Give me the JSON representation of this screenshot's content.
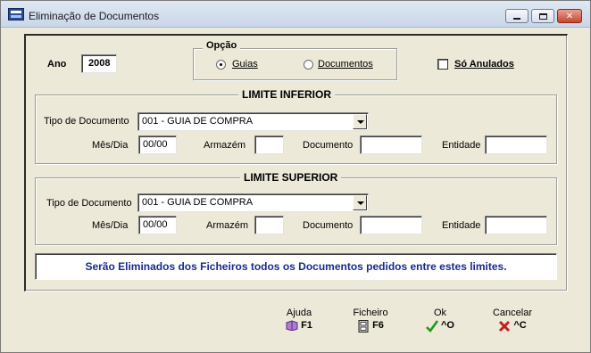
{
  "window": {
    "title": "Eliminação de Documentos"
  },
  "form": {
    "ano": {
      "label": "Ano",
      "value": "2008"
    },
    "opcao": {
      "legend": "Opção",
      "options": [
        {
          "label": "Guias",
          "selected": true
        },
        {
          "label": "Documentos",
          "selected": false
        }
      ]
    },
    "so_anulados": {
      "label": "Só Anulados",
      "checked": false
    },
    "limite_inferior": {
      "legend": "LIMITE INFERIOR",
      "tipo_label": "Tipo de Documento",
      "tipo_value": "001 - GUIA DE COMPRA",
      "mes_dia_label": "Mês/Dia",
      "mes_dia_value": "00/00",
      "armazem_label": "Armazém",
      "armazem_value": "",
      "documento_label": "Documento",
      "documento_value": "",
      "entidade_label": "Entidade",
      "entidade_value": ""
    },
    "limite_superior": {
      "legend": "LIMITE SUPERIOR",
      "tipo_label": "Tipo de Documento",
      "tipo_value": "001 - GUIA DE COMPRA",
      "mes_dia_label": "Mês/Dia",
      "mes_dia_value": "00/00",
      "armazem_label": "Armazém",
      "armazem_value": "",
      "documento_label": "Documento",
      "documento_value": "",
      "entidade_label": "Entidade",
      "entidade_value": ""
    },
    "info": "Serão Eliminados dos Ficheiros todos os Documentos pedidos entre estes limites."
  },
  "footer": {
    "buttons": [
      {
        "caption": "Ajuda",
        "key": "F1",
        "icon": "book-icon",
        "color": "#7a3fa0"
      },
      {
        "caption": "Ficheiro",
        "key": "F6",
        "icon": "cabinet-icon",
        "color": "#333333"
      },
      {
        "caption": "Ok",
        "key": "^O",
        "icon": "checkmark-icon",
        "color": "#1f9a1f"
      },
      {
        "caption": "Cancelar",
        "key": "^C",
        "icon": "x-icon",
        "color": "#c0221a"
      }
    ]
  },
  "colors": {
    "info_text": "#1a2a8c",
    "panel_bg": "#ece9d8"
  }
}
